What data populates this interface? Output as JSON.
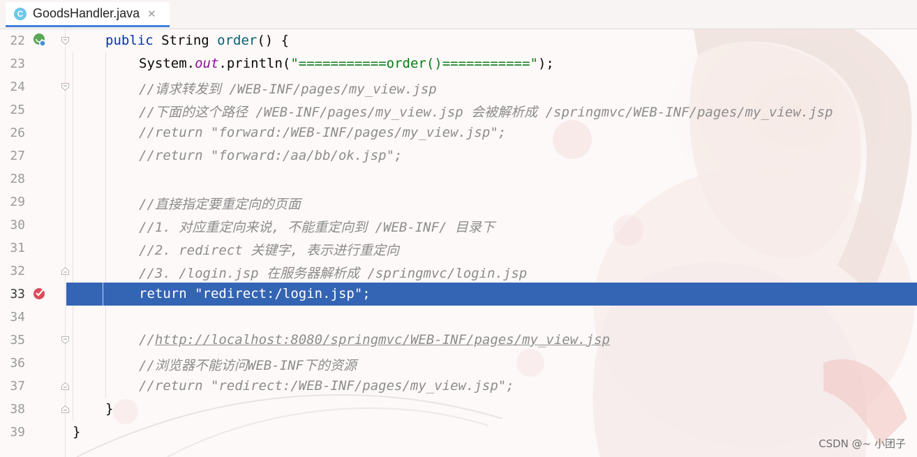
{
  "tab": {
    "label": "GoodsHandler.java",
    "icon": "class-c-icon",
    "icon_letter": "C",
    "close": "✕"
  },
  "colors": {
    "selection": "#3464b4",
    "keyword": "#0033b3",
    "method": "#00627a",
    "string": "#067d17",
    "field": "#871094",
    "comment": "#8c8c8c",
    "tab_underline": "#3d7fd9"
  },
  "lines": [
    {
      "num": "22",
      "indent": 1,
      "tokens": [
        {
          "t": "public ",
          "c": "kw"
        },
        {
          "t": "String ",
          "c": "plain"
        },
        {
          "t": "order",
          "c": "fn"
        },
        {
          "t": "() {",
          "c": "plain"
        }
      ]
    },
    {
      "num": "23",
      "indent": 2,
      "tokens": [
        {
          "t": "System.",
          "c": "plain"
        },
        {
          "t": "out",
          "c": "field"
        },
        {
          "t": ".println(",
          "c": "plain"
        },
        {
          "t": "\"===========order()===========\"",
          "c": "str"
        },
        {
          "t": ");",
          "c": "plain"
        }
      ]
    },
    {
      "num": "24",
      "indent": 2,
      "tokens": [
        {
          "t": "//请求转发到 /WEB-INF/pages/my_view.jsp",
          "c": "cm"
        }
      ]
    },
    {
      "num": "25",
      "indent": 2,
      "tokens": [
        {
          "t": "//下面的这个路径 /WEB-INF/pages/my_view.jsp 会被解析成 /springmvc/WEB-INF/pages/my_view.jsp",
          "c": "cm"
        }
      ]
    },
    {
      "num": "26",
      "indent": 2,
      "tokens": [
        {
          "t": "//return \"forward:/WEB-INF/pages/my_view.jsp\";",
          "c": "cm"
        }
      ]
    },
    {
      "num": "27",
      "indent": 2,
      "tokens": [
        {
          "t": "//return \"forward:/aa/bb/ok.jsp\";",
          "c": "cm"
        }
      ]
    },
    {
      "num": "28",
      "indent": 2,
      "tokens": []
    },
    {
      "num": "29",
      "indent": 2,
      "tokens": [
        {
          "t": "//直接指定要重定向的页面",
          "c": "cm"
        }
      ]
    },
    {
      "num": "30",
      "indent": 2,
      "tokens": [
        {
          "t": "//1. 对应重定向来说, 不能重定向到 /WEB-INF/ 目录下",
          "c": "cm"
        }
      ]
    },
    {
      "num": "31",
      "indent": 2,
      "tokens": [
        {
          "t": "//2. redirect 关键字, 表示进行重定向",
          "c": "cm"
        }
      ]
    },
    {
      "num": "32",
      "indent": 2,
      "tokens": [
        {
          "t": "//3. /login.jsp 在服务器解析成 /springmvc/login.jsp",
          "c": "cm"
        }
      ]
    },
    {
      "num": "33",
      "indent": 2,
      "selected": true,
      "tokens": [
        {
          "t": "return ",
          "c": "kw"
        },
        {
          "t": "\"redirect:/login.jsp\"",
          "c": "str"
        },
        {
          "t": ";",
          "c": "plain"
        }
      ]
    },
    {
      "num": "34",
      "indent": 2,
      "tokens": []
    },
    {
      "num": "35",
      "indent": 2,
      "tokens": [
        {
          "t": "//",
          "c": "cm"
        },
        {
          "t": "http://localhost:8080/springmvc/WEB-INF/pages/my_view.jsp",
          "c": "cm link"
        }
      ]
    },
    {
      "num": "36",
      "indent": 2,
      "tokens": [
        {
          "t": "//浏览器不能访问WEB-INF下的资源",
          "c": "cm"
        }
      ]
    },
    {
      "num": "37",
      "indent": 2,
      "tokens": [
        {
          "t": "//return \"redirect:/WEB-INF/pages/my_view.jsp\";",
          "c": "cm"
        }
      ]
    },
    {
      "num": "38",
      "indent": 1,
      "tokens": [
        {
          "t": "}",
          "c": "plain"
        }
      ]
    },
    {
      "num": "39",
      "indent": 0,
      "tokens": [
        {
          "t": "}",
          "c": "plain"
        }
      ]
    }
  ],
  "gutter_markers": {
    "22": "request-mapping-icon",
    "33": "breakpoint-icon"
  },
  "fold_markers": {
    "22": "fold-open-icon",
    "24": "fold-open-icon",
    "32": "fold-close-icon",
    "35": "fold-open-icon",
    "37": "fold-close-icon",
    "38": "fold-close-icon"
  },
  "watermark": "CSDN @~ 小团子"
}
